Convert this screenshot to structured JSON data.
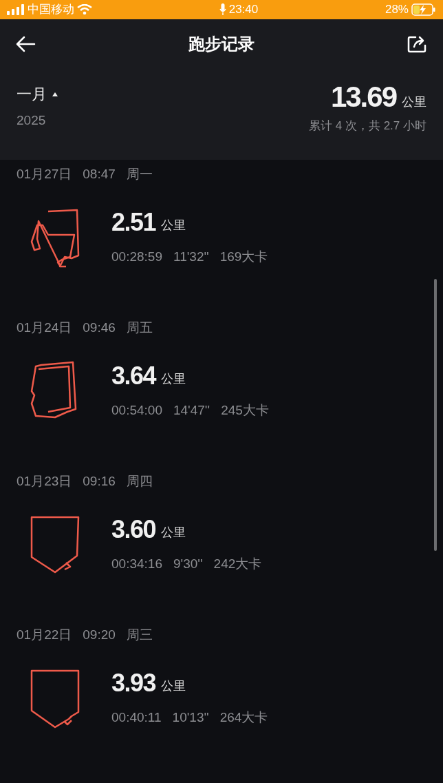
{
  "status_bar": {
    "carrier": "中国移动",
    "time": "23:40",
    "battery": "28%"
  },
  "nav": {
    "title": "跑步记录"
  },
  "summary": {
    "month": "一月",
    "year": "2025",
    "distance": "13.69",
    "unit": "公里",
    "totals": "累计 4 次，共 2.7 小时"
  },
  "records": [
    {
      "date": "01月27日",
      "time": "08:47",
      "weekday": "周一",
      "distance": "2.51",
      "unit": "公里",
      "duration": "00:28:59",
      "pace": "11'32''",
      "calories": "169大卡"
    },
    {
      "date": "01月24日",
      "time": "09:46",
      "weekday": "周五",
      "distance": "3.64",
      "unit": "公里",
      "duration": "00:54:00",
      "pace": "14'47''",
      "calories": "245大卡"
    },
    {
      "date": "01月23日",
      "time": "09:16",
      "weekday": "周四",
      "distance": "3.60",
      "unit": "公里",
      "duration": "00:34:16",
      "pace": "9'30''",
      "calories": "242大卡"
    },
    {
      "date": "01月22日",
      "time": "09:20",
      "weekday": "周三",
      "distance": "3.93",
      "unit": "公里",
      "duration": "00:40:11",
      "pace": "10'13''",
      "calories": "264大卡"
    }
  ]
}
